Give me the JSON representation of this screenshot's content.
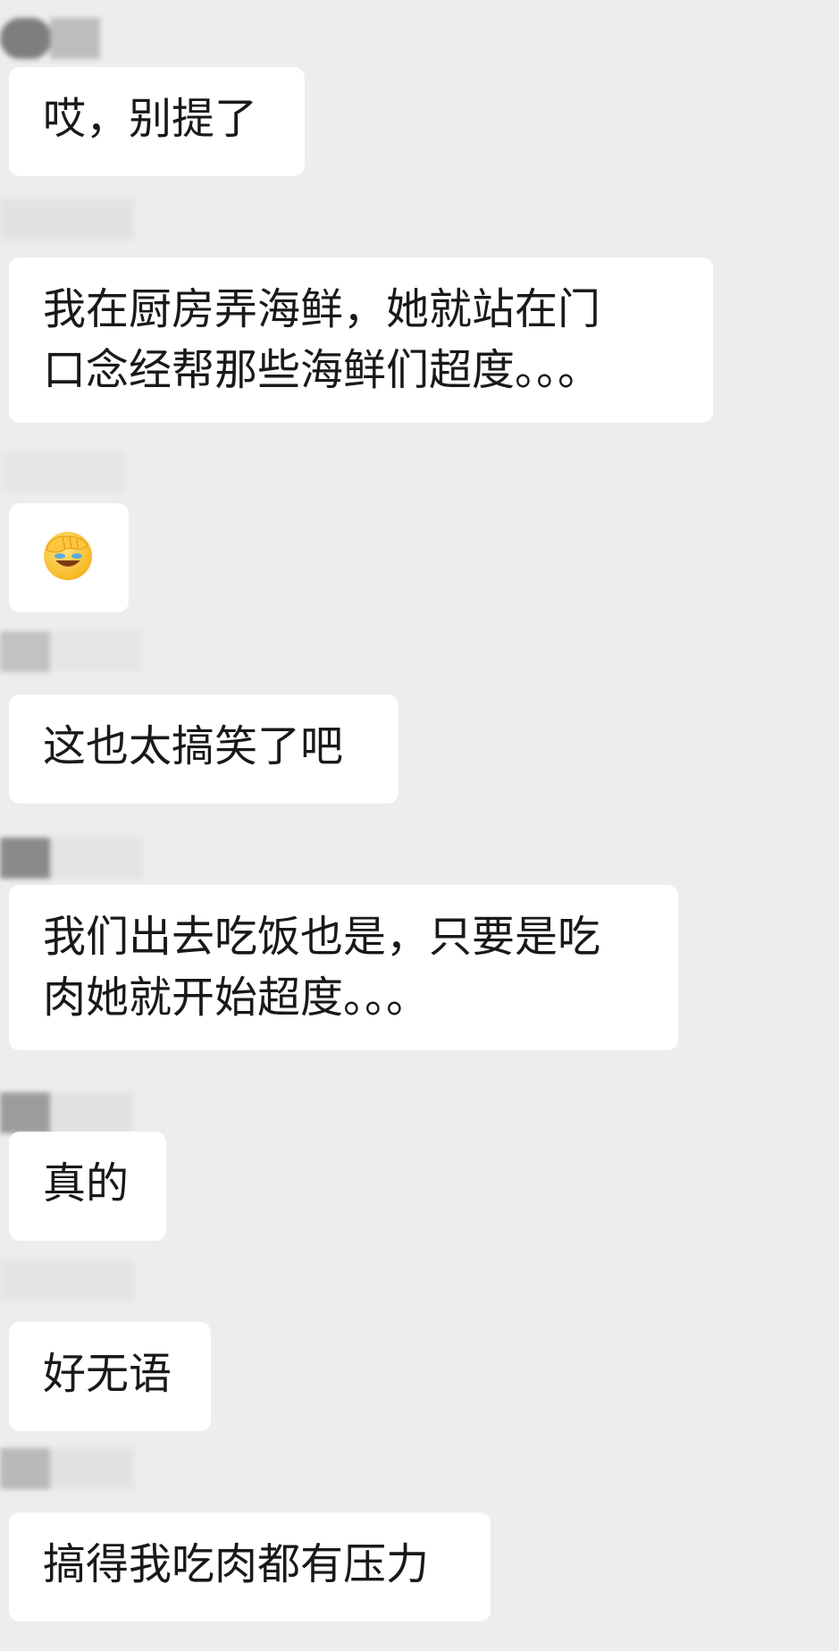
{
  "chat": {
    "messages": [
      {
        "type": "text",
        "lines": [
          "哎，别提了"
        ]
      },
      {
        "type": "text",
        "lines": [
          "我在厨房弄海鲜，她就站在门",
          "口念经帮那些海鲜们超度。。。"
        ]
      },
      {
        "type": "emoji",
        "icon": "facepalm-icon"
      },
      {
        "type": "text",
        "lines": [
          "这也太搞笑了吧"
        ]
      },
      {
        "type": "text",
        "lines": [
          "我们出去吃饭也是，只要是吃",
          "肉她就开始超度。。。"
        ]
      },
      {
        "type": "text",
        "lines": [
          "真的"
        ]
      },
      {
        "type": "text",
        "lines": [
          "好无语"
        ]
      },
      {
        "type": "text",
        "lines": [
          "搞得我吃肉都有压力"
        ]
      }
    ]
  },
  "colors": {
    "background": "#ededed",
    "bubble": "#ffffff",
    "text": "#191919",
    "redacted": "#9a9a9a"
  }
}
